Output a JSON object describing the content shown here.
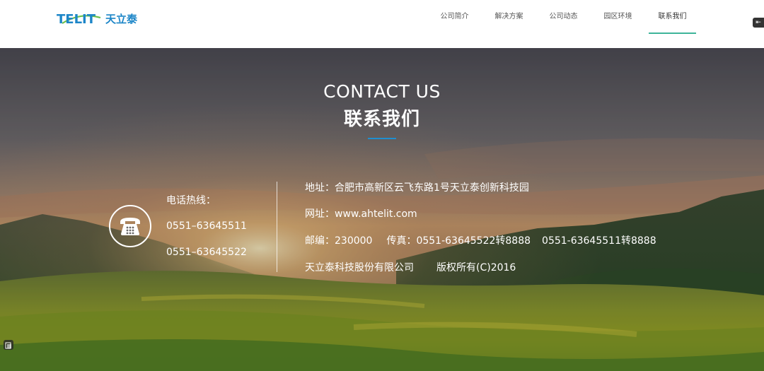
{
  "header": {
    "logo": {
      "latin": "TELIT",
      "cn": "天立泰"
    },
    "nav": [
      {
        "label": "公司简介"
      },
      {
        "label": "解决方案"
      },
      {
        "label": "公司动态"
      },
      {
        "label": "园区环境"
      },
      {
        "label": "联系我们"
      }
    ],
    "active_nav": "联系我们",
    "side_tab_icon": "collapse-arrow-icon"
  },
  "hero": {
    "title_en": "CONTACT US",
    "title_cn": "联系我们",
    "hotline_label": "电话热线：",
    "phones": [
      "0551–63645511",
      "0551–63645522"
    ],
    "address": "地址：合肥市高新区云飞东路1号天立泰创新科技园",
    "website": "网址：www.ahtelit.com",
    "postcode": "邮编：230000",
    "fax": "传真：0551-63645522转8888",
    "fax2": "0551-63645511转8888",
    "company": "天立泰科技股份有限公司",
    "copyright": "版权所有(C)2016"
  },
  "colors": {
    "accent_green": "#3eb59a",
    "accent_blue": "#1f8fd0",
    "logo_blue": "#1d86c8"
  },
  "icons": {
    "phone": "telephone-icon",
    "corner": "copy-icon"
  }
}
